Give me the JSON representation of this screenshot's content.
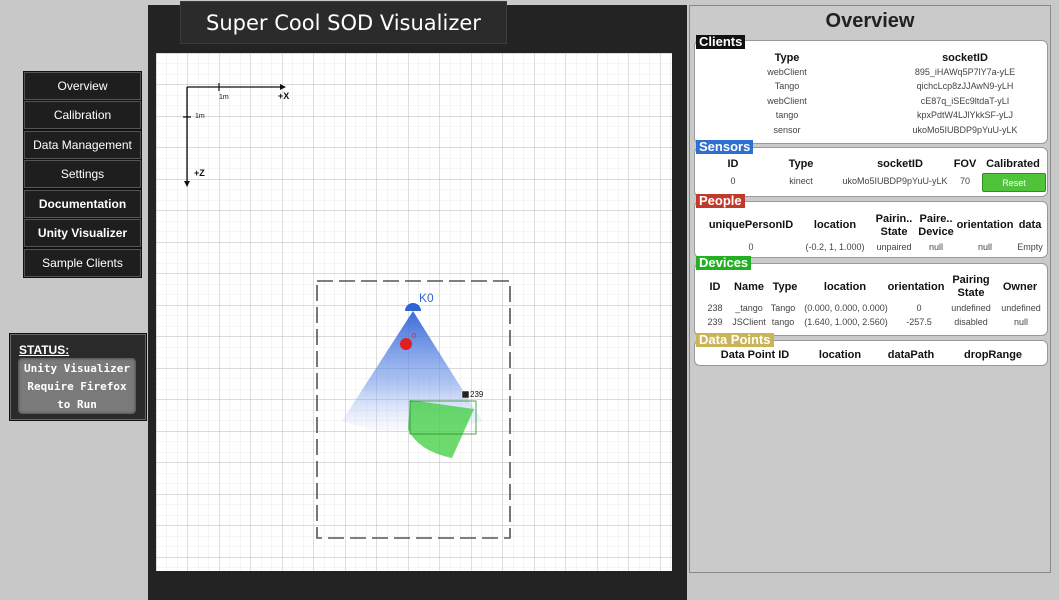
{
  "nav": {
    "items": [
      {
        "label": "Overview"
      },
      {
        "label": "Calibration"
      },
      {
        "label": "Data Management"
      },
      {
        "label": "Settings"
      },
      {
        "label": "Documentation"
      },
      {
        "label": "Unity Visualizer"
      },
      {
        "label": "Sample Clients"
      }
    ]
  },
  "status": {
    "label": "STATUS:",
    "line1": "Unity Visualizer",
    "line2": "Require Firefox",
    "line3": "to Run"
  },
  "visualizer": {
    "title": "Super Cool SOD Visualizer",
    "axis_x": "+X",
    "axis_z": "+Z",
    "scale_x": "1m",
    "scale_z": "1m",
    "sensor_label": "K0",
    "person_label": "0",
    "device_label": "239",
    "colors": {
      "sensor": "#2f63d6",
      "person": "#e02020",
      "device": "#3ccd3c"
    }
  },
  "overview": {
    "title": "Overview",
    "clients": {
      "label": "Clients",
      "color": "#111111",
      "headers": [
        "Type",
        "socketID"
      ],
      "rows": [
        [
          "webClient",
          "895_iHAWq5P7lY7a-yLE"
        ],
        [
          "Tango",
          "qichcLcp8zJJAwN9-yLH"
        ],
        [
          "webClient",
          "cE87q_iSEc9ltdaT-yLI"
        ],
        [
          "tango",
          "kpxPdtW4LJlYkkSF-yLJ"
        ],
        [
          "sensor",
          "ukoMo5IUBDP9pYuU-yLK"
        ]
      ]
    },
    "sensors": {
      "label": "Sensors",
      "color": "#2f6fd0",
      "headers": [
        "ID",
        "Type",
        "socketID",
        "FOV",
        "Calibrated"
      ],
      "row": [
        "0",
        "kinect",
        "ukoMo5IUBDP9pYuU-yLK",
        "70"
      ],
      "reset_label": "Reset"
    },
    "people": {
      "label": "People",
      "color": "#c0392b",
      "headers": [
        "uniquePersonID",
        "location",
        "Pairin..",
        "State",
        "Paire..",
        "Device",
        "orientation",
        "data"
      ],
      "row": [
        "0",
        "(-0.2, 1, 1.000)",
        "unpaired",
        "null",
        "null",
        "Empty"
      ]
    },
    "devices": {
      "label": "Devices",
      "color": "#22b022",
      "headers": [
        "ID",
        "Name",
        "Type",
        "location",
        "orientation",
        "Pairing",
        "State",
        "Owner"
      ],
      "rows": [
        [
          "238",
          "_tango",
          "Tango",
          "(0.000, 0.000, 0.000)",
          "0",
          "undefined",
          "undefined"
        ],
        [
          "239",
          "JSClient",
          "tango",
          "(1.640, 1.000, 2.560)",
          "-257.5",
          "disabled",
          "null"
        ]
      ]
    },
    "data_points": {
      "label": "Data Points",
      "color": "#c9b458",
      "headers": [
        "Data Point ID",
        "location",
        "dataPath",
        "dropRange"
      ]
    }
  }
}
